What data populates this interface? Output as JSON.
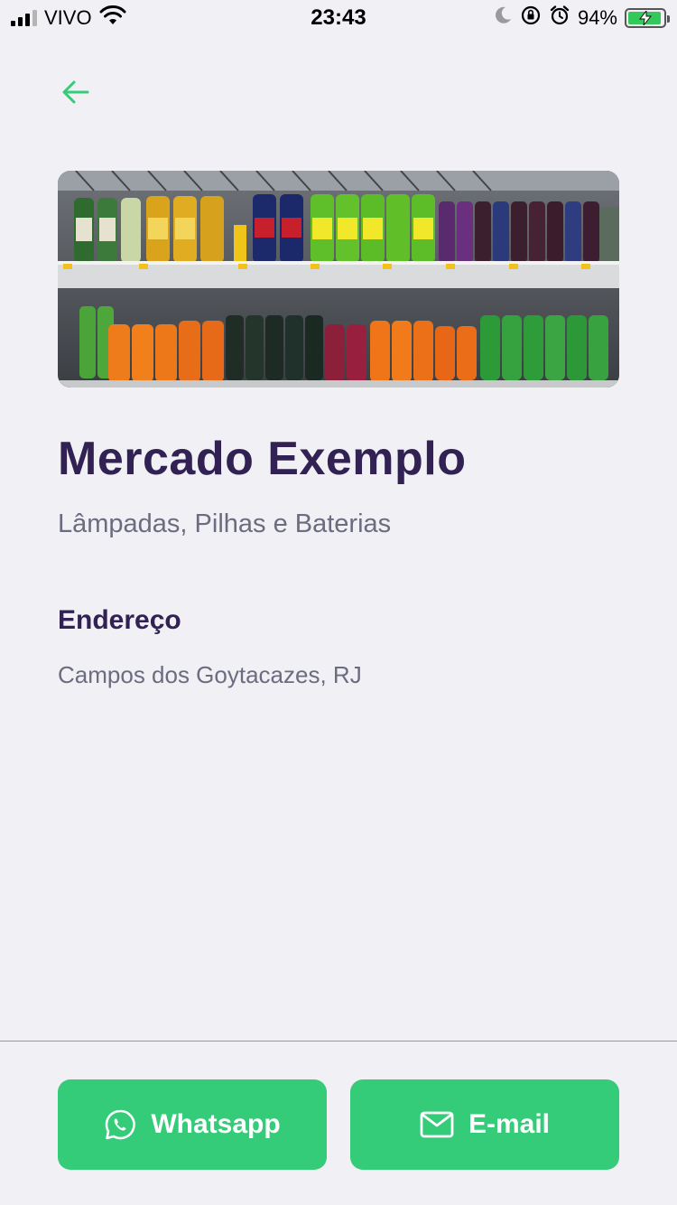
{
  "status_bar": {
    "carrier": "VIVO",
    "time": "23:43",
    "battery_percent": "94%",
    "battery_level": 0.94,
    "icons": [
      "signal-icon",
      "wifi-icon",
      "moon-icon",
      "rotation-lock-icon",
      "alarm-icon",
      "battery-icon"
    ]
  },
  "header": {
    "back_icon": "arrow-left-icon"
  },
  "point": {
    "image_alt": "Soft drink shelves",
    "name": "Mercado Exemplo",
    "items": "Lâmpadas, Pilhas e Baterias"
  },
  "address": {
    "heading": "Endereço",
    "value": "Campos dos Goytacazes, RJ"
  },
  "footer": {
    "whatsapp_label": "Whatsapp",
    "whatsapp_icon": "whatsapp-icon",
    "email_label": "E-mail",
    "email_icon": "mail-icon"
  },
  "colors": {
    "background": "#f0f0f5",
    "primary": "#34cb79",
    "title": "#322153",
    "text": "#6c6c80"
  }
}
